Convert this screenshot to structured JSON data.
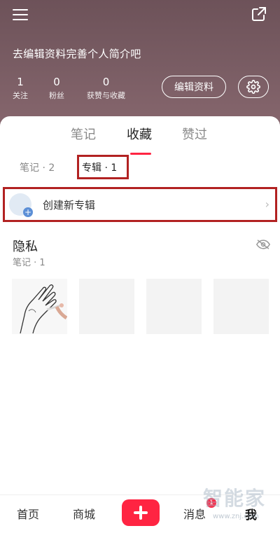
{
  "header": {
    "bio_prompt": "去编辑资料完善个人简介吧",
    "stats": [
      {
        "value": "1",
        "label": "关注"
      },
      {
        "value": "0",
        "label": "粉丝"
      },
      {
        "value": "0",
        "label": "获赞与收藏"
      }
    ],
    "edit_profile_label": "编辑资料",
    "icons": {
      "menu": "menu-icon",
      "share": "share-icon",
      "settings": "gear-icon"
    }
  },
  "tabs": [
    {
      "label": "笔记"
    },
    {
      "label": "收藏"
    },
    {
      "label": "赞过"
    }
  ],
  "subtabs": {
    "notes": "笔记 · 2",
    "albums": "专辑 · 1"
  },
  "create_album": {
    "label": "创建新专辑",
    "chevron": "›"
  },
  "album": {
    "title": "隐私",
    "subtitle": "笔记 · 1",
    "visibility_icon": "eye-hidden-icon"
  },
  "bottom_nav": {
    "home": "首页",
    "mall": "商城",
    "plus": "+",
    "messages": "消息",
    "message_badge": "1",
    "me": "我"
  },
  "watermark": {
    "brand": "智能家",
    "url": "www.znj.com"
  },
  "colors": {
    "accent": "#ff2442",
    "highlight_box": "#b22222",
    "header_bg": "#7a5d64"
  }
}
